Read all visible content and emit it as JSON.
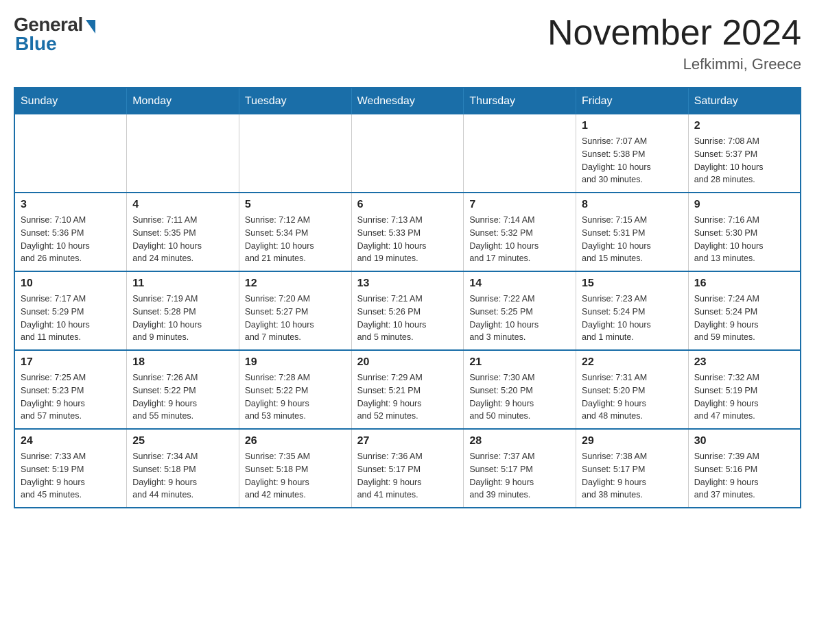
{
  "header": {
    "logo_general": "General",
    "logo_blue": "Blue",
    "month_title": "November 2024",
    "location": "Lefkimmi, Greece"
  },
  "days_of_week": [
    "Sunday",
    "Monday",
    "Tuesday",
    "Wednesday",
    "Thursday",
    "Friday",
    "Saturday"
  ],
  "weeks": [
    [
      {
        "day": "",
        "info": ""
      },
      {
        "day": "",
        "info": ""
      },
      {
        "day": "",
        "info": ""
      },
      {
        "day": "",
        "info": ""
      },
      {
        "day": "",
        "info": ""
      },
      {
        "day": "1",
        "info": "Sunrise: 7:07 AM\nSunset: 5:38 PM\nDaylight: 10 hours\nand 30 minutes."
      },
      {
        "day": "2",
        "info": "Sunrise: 7:08 AM\nSunset: 5:37 PM\nDaylight: 10 hours\nand 28 minutes."
      }
    ],
    [
      {
        "day": "3",
        "info": "Sunrise: 7:10 AM\nSunset: 5:36 PM\nDaylight: 10 hours\nand 26 minutes."
      },
      {
        "day": "4",
        "info": "Sunrise: 7:11 AM\nSunset: 5:35 PM\nDaylight: 10 hours\nand 24 minutes."
      },
      {
        "day": "5",
        "info": "Sunrise: 7:12 AM\nSunset: 5:34 PM\nDaylight: 10 hours\nand 21 minutes."
      },
      {
        "day": "6",
        "info": "Sunrise: 7:13 AM\nSunset: 5:33 PM\nDaylight: 10 hours\nand 19 minutes."
      },
      {
        "day": "7",
        "info": "Sunrise: 7:14 AM\nSunset: 5:32 PM\nDaylight: 10 hours\nand 17 minutes."
      },
      {
        "day": "8",
        "info": "Sunrise: 7:15 AM\nSunset: 5:31 PM\nDaylight: 10 hours\nand 15 minutes."
      },
      {
        "day": "9",
        "info": "Sunrise: 7:16 AM\nSunset: 5:30 PM\nDaylight: 10 hours\nand 13 minutes."
      }
    ],
    [
      {
        "day": "10",
        "info": "Sunrise: 7:17 AM\nSunset: 5:29 PM\nDaylight: 10 hours\nand 11 minutes."
      },
      {
        "day": "11",
        "info": "Sunrise: 7:19 AM\nSunset: 5:28 PM\nDaylight: 10 hours\nand 9 minutes."
      },
      {
        "day": "12",
        "info": "Sunrise: 7:20 AM\nSunset: 5:27 PM\nDaylight: 10 hours\nand 7 minutes."
      },
      {
        "day": "13",
        "info": "Sunrise: 7:21 AM\nSunset: 5:26 PM\nDaylight: 10 hours\nand 5 minutes."
      },
      {
        "day": "14",
        "info": "Sunrise: 7:22 AM\nSunset: 5:25 PM\nDaylight: 10 hours\nand 3 minutes."
      },
      {
        "day": "15",
        "info": "Sunrise: 7:23 AM\nSunset: 5:24 PM\nDaylight: 10 hours\nand 1 minute."
      },
      {
        "day": "16",
        "info": "Sunrise: 7:24 AM\nSunset: 5:24 PM\nDaylight: 9 hours\nand 59 minutes."
      }
    ],
    [
      {
        "day": "17",
        "info": "Sunrise: 7:25 AM\nSunset: 5:23 PM\nDaylight: 9 hours\nand 57 minutes."
      },
      {
        "day": "18",
        "info": "Sunrise: 7:26 AM\nSunset: 5:22 PM\nDaylight: 9 hours\nand 55 minutes."
      },
      {
        "day": "19",
        "info": "Sunrise: 7:28 AM\nSunset: 5:22 PM\nDaylight: 9 hours\nand 53 minutes."
      },
      {
        "day": "20",
        "info": "Sunrise: 7:29 AM\nSunset: 5:21 PM\nDaylight: 9 hours\nand 52 minutes."
      },
      {
        "day": "21",
        "info": "Sunrise: 7:30 AM\nSunset: 5:20 PM\nDaylight: 9 hours\nand 50 minutes."
      },
      {
        "day": "22",
        "info": "Sunrise: 7:31 AM\nSunset: 5:20 PM\nDaylight: 9 hours\nand 48 minutes."
      },
      {
        "day": "23",
        "info": "Sunrise: 7:32 AM\nSunset: 5:19 PM\nDaylight: 9 hours\nand 47 minutes."
      }
    ],
    [
      {
        "day": "24",
        "info": "Sunrise: 7:33 AM\nSunset: 5:19 PM\nDaylight: 9 hours\nand 45 minutes."
      },
      {
        "day": "25",
        "info": "Sunrise: 7:34 AM\nSunset: 5:18 PM\nDaylight: 9 hours\nand 44 minutes."
      },
      {
        "day": "26",
        "info": "Sunrise: 7:35 AM\nSunset: 5:18 PM\nDaylight: 9 hours\nand 42 minutes."
      },
      {
        "day": "27",
        "info": "Sunrise: 7:36 AM\nSunset: 5:17 PM\nDaylight: 9 hours\nand 41 minutes."
      },
      {
        "day": "28",
        "info": "Sunrise: 7:37 AM\nSunset: 5:17 PM\nDaylight: 9 hours\nand 39 minutes."
      },
      {
        "day": "29",
        "info": "Sunrise: 7:38 AM\nSunset: 5:17 PM\nDaylight: 9 hours\nand 38 minutes."
      },
      {
        "day": "30",
        "info": "Sunrise: 7:39 AM\nSunset: 5:16 PM\nDaylight: 9 hours\nand 37 minutes."
      }
    ]
  ]
}
